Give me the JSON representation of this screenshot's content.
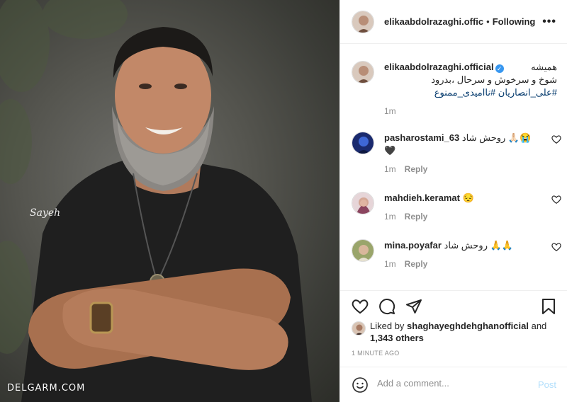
{
  "photo": {
    "watermark": "DELGARM.COM",
    "signature": "Sayeh"
  },
  "header": {
    "username": "elikaabdolrazaghi.offic",
    "separator": "•",
    "follow_status": "Following"
  },
  "caption": {
    "username": "elikaabdolrazaghi.official",
    "verified_mark": "✓",
    "line1": "همیشه",
    "line2": "شوخ و سرخوش و سرحال ،بدرود",
    "tags": "#علی_انصاریان #ناامیدی_ممنوع",
    "time": "1m"
  },
  "comments": [
    {
      "username": "pasharostami_63",
      "text": "روحش شاد 🙏🏻😭",
      "extra": "🖤",
      "time": "1m",
      "reply": "Reply"
    },
    {
      "username": "mahdieh.keramat",
      "text": "😔",
      "extra": "",
      "time": "1m",
      "reply": "Reply"
    },
    {
      "username": "mina.poyafar",
      "text": "روحش شاد 🙏🙏",
      "extra": "",
      "time": "1m",
      "reply": "Reply"
    }
  ],
  "likes": {
    "prefix": "Liked by",
    "liker": "shaghayeghdehghanofficial",
    "and": "and",
    "others": "1,343 others"
  },
  "timestamp": "1 MINUTE AGO",
  "add_comment": {
    "placeholder": "Add a comment...",
    "post_label": "Post"
  },
  "colors": {
    "link": "#00376b",
    "verified": "#3897f0",
    "post_disabled": "#b2dffc",
    "muted": "#8e8e8e"
  }
}
